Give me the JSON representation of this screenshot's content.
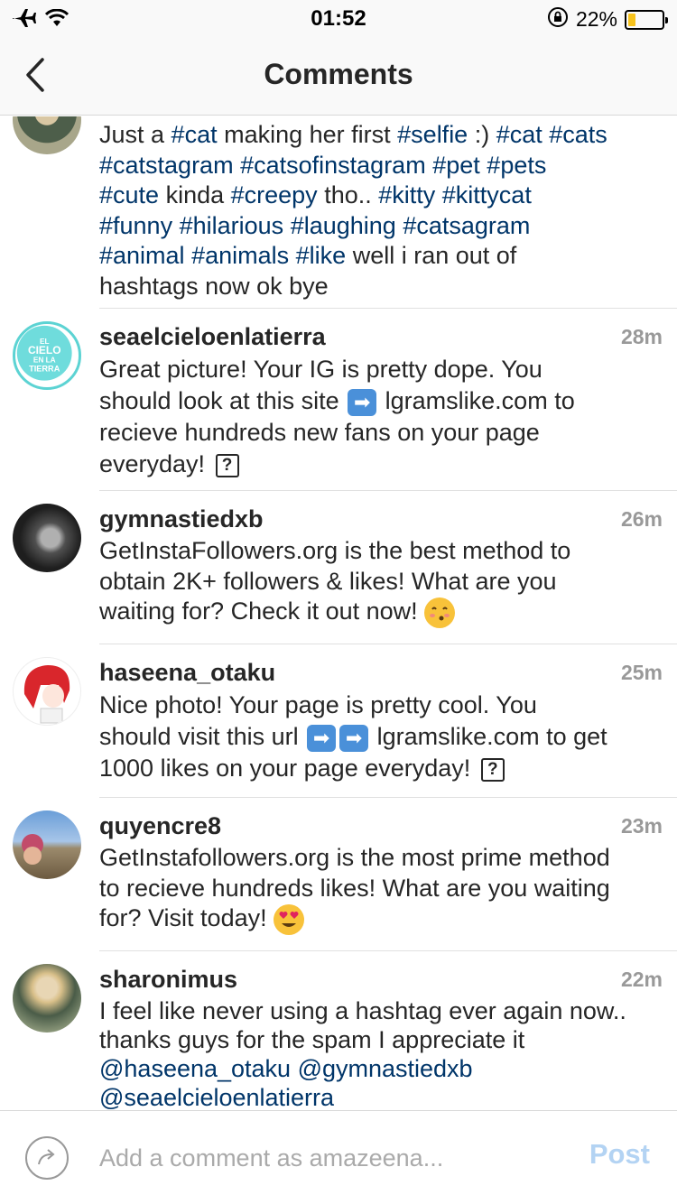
{
  "status_bar": {
    "time": "01:52",
    "battery_text": "22%",
    "battery_level": 0.22,
    "icons": [
      "airplane-icon",
      "wifi-icon",
      "rotation-lock-icon",
      "battery-icon"
    ]
  },
  "nav": {
    "title": "Comments",
    "back_icon": "chevron-left-icon"
  },
  "caption": {
    "lines": [
      [
        [
          "tag",
          "#cat"
        ],
        [
          "text",
          " making her first "
        ],
        [
          "tag",
          "#selfie"
        ],
        [
          "text",
          " :) "
        ],
        [
          "tag",
          "#cat"
        ],
        [
          "text",
          " "
        ],
        [
          "tag",
          "#cats"
        ]
      ],
      [
        [
          "tag",
          "#catstagram"
        ],
        [
          "text",
          " "
        ],
        [
          "tag",
          "#catsofinstagram"
        ],
        [
          "text",
          " "
        ],
        [
          "tag",
          "#pet"
        ],
        [
          "text",
          " "
        ],
        [
          "tag",
          "#pets"
        ]
      ],
      [
        [
          "tag",
          "#cute"
        ],
        [
          "text",
          " kinda "
        ],
        [
          "tag",
          "#creepy"
        ],
        [
          "text",
          " tho.. "
        ],
        [
          "tag",
          "#kitty"
        ],
        [
          "text",
          " "
        ],
        [
          "tag",
          "#kittycat"
        ]
      ],
      [
        [
          "tag",
          "#funny"
        ],
        [
          "text",
          " "
        ],
        [
          "tag",
          "#hilarious"
        ],
        [
          "text",
          " "
        ],
        [
          "tag",
          "#laughing"
        ],
        [
          "text",
          " "
        ],
        [
          "tag",
          "#catsagram"
        ]
      ],
      [
        [
          "tag",
          "#animal"
        ],
        [
          "text",
          " "
        ],
        [
          "tag",
          "#animals"
        ],
        [
          "text",
          " "
        ],
        [
          "tag",
          "#like"
        ],
        [
          "text",
          " well i ran out of"
        ]
      ],
      [
        [
          "text",
          "hashtags now ok bye"
        ]
      ]
    ],
    "prefix": "Just a "
  },
  "comments": [
    {
      "username": "seaelcieloenlatierra",
      "time": "28m",
      "avatar_text": "EL CIELO EN LA TIERRA",
      "lines": [
        "Great picture! Your IG is pretty dope. You",
        "should look at this site {arrow} lgramslike.com to",
        "recieve hundreds new fans on your page",
        "everyday! {q}"
      ]
    },
    {
      "username": "gymnastiedxb",
      "time": "26m",
      "lines": [
        "GetInstaFollowers.org is the best method to",
        "obtain 2K+ followers & likes! What are you",
        "waiting for? Check it out now! {kiss}"
      ]
    },
    {
      "username": "haseena_otaku",
      "time": "25m",
      "lines": [
        "Nice photo! Your page is pretty cool. You",
        "should visit this url {arrow}{arrow} lgramslike.com to get",
        "1000 likes on your page everyday! {q}"
      ]
    },
    {
      "username": "quyencre8",
      "time": "23m",
      "lines": [
        "GetInstafollowers.org is the most prime method",
        "to recieve hundreds likes! What are you waiting",
        "for? Visit today! {hearteyes}"
      ]
    },
    {
      "username": "sharonimus",
      "time": "22m",
      "lines": [
        "I feel like never using a hashtag ever again now..",
        "thanks guys for the spam I appreciate it",
        "@haseena_otaku @gymnastiedxb",
        "@seaelcieloenlatierra"
      ],
      "mention_lines": [
        2,
        3
      ]
    }
  ],
  "composer": {
    "placeholder": "Add a comment as amazeena...",
    "post_label": "Post",
    "share_icon": "share-arrow-icon"
  },
  "colors": {
    "hashtag": "#003569",
    "time": "#999999",
    "post_disabled": "#b3d3f3"
  }
}
